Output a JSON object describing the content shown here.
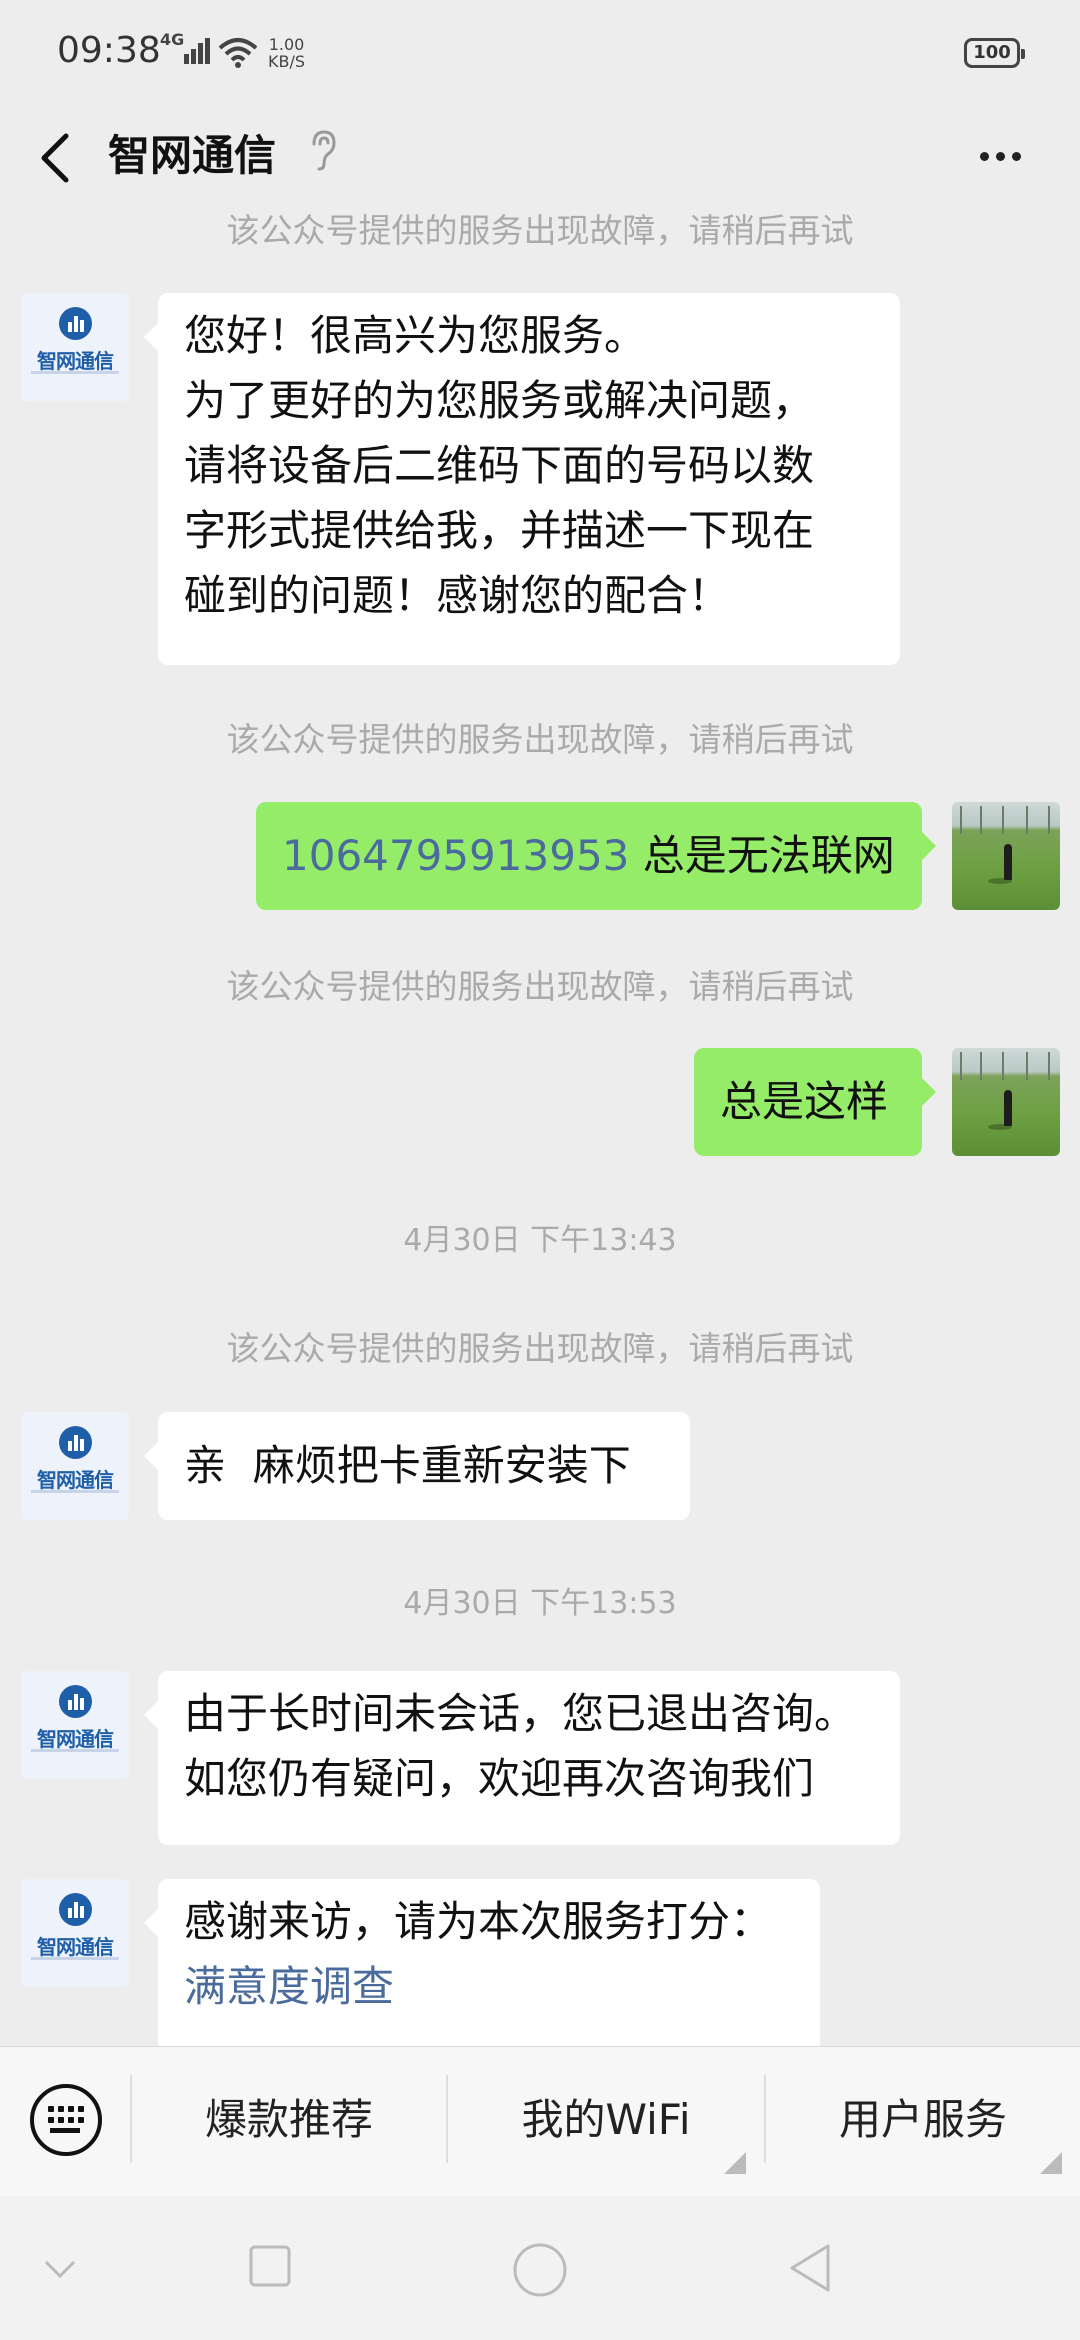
{
  "status_bar": {
    "time": "09:38",
    "network": "4G",
    "speed_value": "1.00",
    "speed_unit": "KB/S",
    "battery": "100"
  },
  "header": {
    "title": "智网通信"
  },
  "avatars": {
    "logo_text": "智网通信"
  },
  "messages": {
    "notice": "该公众号提供的服务出现故障，请稍后再试",
    "welcome_lines": [
      "您好！很高兴为您服务。",
      "为了更好的为您服务或解决问题，",
      "请将设备后二维码下面的号码以数",
      "字形式提供给我，并描述一下现在",
      "碰到的问题！感谢您的配合！"
    ],
    "user_msg1_number": "1064795913953",
    "user_msg1_text": " 总是无法联网",
    "user_msg2": "总是这样",
    "timestamp1": "4月30日 下午13:43",
    "agent_msg": "亲  麻烦把卡重新安装下",
    "timestamp2": "4月30日 下午13:53",
    "timeout_lines": [
      "由于长时间未会话，您已退出咨询。",
      "如您仍有疑问，欢迎再次咨询我们"
    ],
    "rating_line": "感谢来访，请为本次服务打分：",
    "survey_link": "满意度调查"
  },
  "menu": {
    "items": [
      "爆款推荐",
      "我的WiFi",
      "用户服务"
    ]
  },
  "colors": {
    "background": "#ededed",
    "user_bubble": "#95ec69",
    "agent_bubble": "#ffffff",
    "link": "#4a6b9c",
    "brand": "#1f5ea8"
  }
}
